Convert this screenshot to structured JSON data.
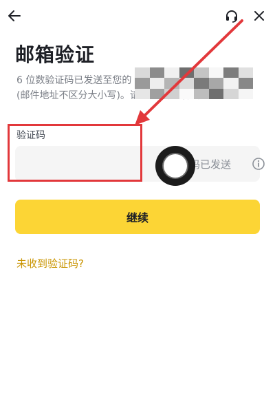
{
  "nav": {
    "back_icon": "arrow-left-icon",
    "support_icon": "headset-icon",
    "close_icon": "close-icon"
  },
  "page": {
    "title": "邮箱验证",
    "desc_line1": "6 位数验证码已发送至您的",
    "desc_line2": "(邮件地址不区分大小写)。请在 30 分钟内输入。"
  },
  "form": {
    "label": "验证码",
    "code_value": "",
    "code_placeholder": "",
    "sent_text": "码已发送",
    "info_icon": "info-circle-icon"
  },
  "actions": {
    "continue_label": "继续",
    "no_code_link": "未收到验证码?"
  },
  "colors": {
    "accent": "#fcd535",
    "link": "#c99400",
    "annotation_red": "#e2383b"
  }
}
